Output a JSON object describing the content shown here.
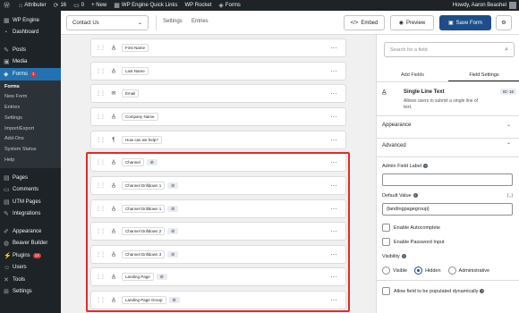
{
  "adminbar": {
    "site_name": "Attributer",
    "updates": "16",
    "comments": "0",
    "new_label": "+ New",
    "wpe_quick_links": "WP Engine Quick Links",
    "wp_rocket": "WP Rocket",
    "forms": "Forms",
    "howdy": "Howdy, Aaron Beashel"
  },
  "sidebar": {
    "items_top": [
      {
        "label": "WP Engine",
        "icon": "wp-engine-icon"
      },
      {
        "label": "Dashboard",
        "icon": "dashboard-icon"
      }
    ],
    "items_mid": [
      {
        "label": "Posts",
        "icon": "pin-icon"
      },
      {
        "label": "Media",
        "icon": "media-icon"
      }
    ],
    "forms": {
      "label": "Forms",
      "badge": "1"
    },
    "submenu": [
      "Forms",
      "New Form",
      "Entries",
      "Settings",
      "Import/Export",
      "Add-Ons",
      "System Status",
      "Help"
    ],
    "items_bottom": [
      {
        "label": "Pages",
        "icon": "pages-icon"
      },
      {
        "label": "Comments",
        "icon": "comments-icon"
      },
      {
        "label": "UTM Pages",
        "icon": "pages-icon"
      },
      {
        "label": "Integrations",
        "icon": "pin-icon"
      }
    ],
    "items_end": [
      {
        "label": "Appearance",
        "icon": "appearance-icon"
      },
      {
        "label": "Beaver Builder",
        "icon": "beaver-icon"
      },
      {
        "label": "Plugins",
        "icon": "plugins-icon",
        "badge": "14"
      },
      {
        "label": "Users",
        "icon": "users-icon"
      },
      {
        "label": "Tools",
        "icon": "tools-icon"
      },
      {
        "label": "Settings",
        "icon": "settings-icon"
      }
    ]
  },
  "topbar": {
    "form_name": "Contact Us",
    "settings_link": "Settings",
    "entries_link": "Entries",
    "embed_label": "Embed",
    "preview_label": "Preview",
    "save_label": "Save Form"
  },
  "fields": [
    {
      "label": "First Name",
      "icon": "text-icon",
      "hidden": false
    },
    {
      "label": "Last Name",
      "icon": "text-icon",
      "hidden": false
    },
    {
      "label": "Email",
      "icon": "email-icon",
      "hidden": false
    },
    {
      "label": "Company Name",
      "icon": "text-icon",
      "hidden": false
    },
    {
      "label": "How can we help?",
      "icon": "paragraph-icon",
      "hidden": false
    },
    {
      "label": "Channel",
      "icon": "text-icon",
      "hidden": true
    },
    {
      "label": "Channel Drilldown 1",
      "icon": "text-icon",
      "hidden": true
    },
    {
      "label": "Channel Drilldown 1",
      "icon": "text-icon",
      "hidden": true
    },
    {
      "label": "Channel Drilldown 2",
      "icon": "text-icon",
      "hidden": true
    },
    {
      "label": "Channel Drilldown 3",
      "icon": "text-icon",
      "hidden": true
    },
    {
      "label": "Landing Page",
      "icon": "text-icon",
      "hidden": true
    },
    {
      "label": "Landing Page Group",
      "icon": "text-icon",
      "hidden": true
    }
  ],
  "panel": {
    "search_placeholder": "Search for a field",
    "tab_add_fields": "Add Fields",
    "tab_field_settings": "Field Settings",
    "field_type": "Single Line Text",
    "field_id": "ID: 16",
    "field_desc": "Allows users to submit a single line of text.",
    "appearance": "Appearance",
    "advanced": "Advanced",
    "admin_label": "Admin Field Label",
    "admin_value": "",
    "default_value_label": "Default Value",
    "merge_tag": "{..}",
    "default_value": "{landingpagegroup}",
    "enable_autocomplete": "Enable Autocomplete",
    "enable_password": "Enable Password Input",
    "visibility_label": "Visibility",
    "visibility_options": [
      "Visible",
      "Hidden",
      "Administrative"
    ],
    "visibility_selected": "Hidden",
    "allow_dynamic": "Allow field to be populated dynamically",
    "help_glyph": "?"
  },
  "colors": {
    "admin_dark": "#1d2327",
    "accent_blue": "#2271b1",
    "save_button": "#1d4e89",
    "highlight_red": "#e02b27"
  }
}
